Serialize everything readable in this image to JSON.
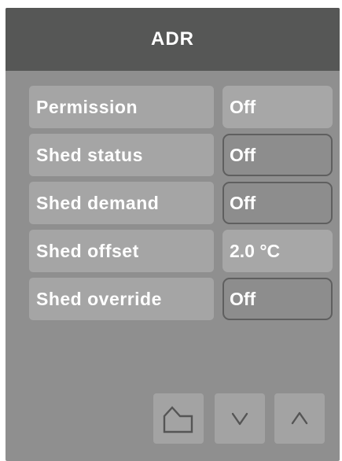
{
  "header": {
    "title": "ADR"
  },
  "rows": [
    {
      "label": "Permission",
      "value": "Off",
      "editable": false
    },
    {
      "label": "Shed status",
      "value": "Off",
      "editable": true
    },
    {
      "label": "Shed demand",
      "value": "Off",
      "editable": true
    },
    {
      "label": "Shed offset",
      "value": "2.0 °C",
      "editable": false
    },
    {
      "label": "Shed override",
      "value": "Off",
      "editable": true
    }
  ],
  "nav": {
    "home_icon": "home-icon",
    "down_icon": "chevron-down-icon",
    "up_icon": "chevron-up-icon"
  },
  "colors": {
    "header_bg": "#565756",
    "panel_bg": "#8f8f8f",
    "label_bg": "#a5a5a5",
    "value_bg": "#a7a7a7",
    "editable_bg": "#8d8d8d",
    "editable_border": "#5f5f5f",
    "text": "#ffffff"
  }
}
